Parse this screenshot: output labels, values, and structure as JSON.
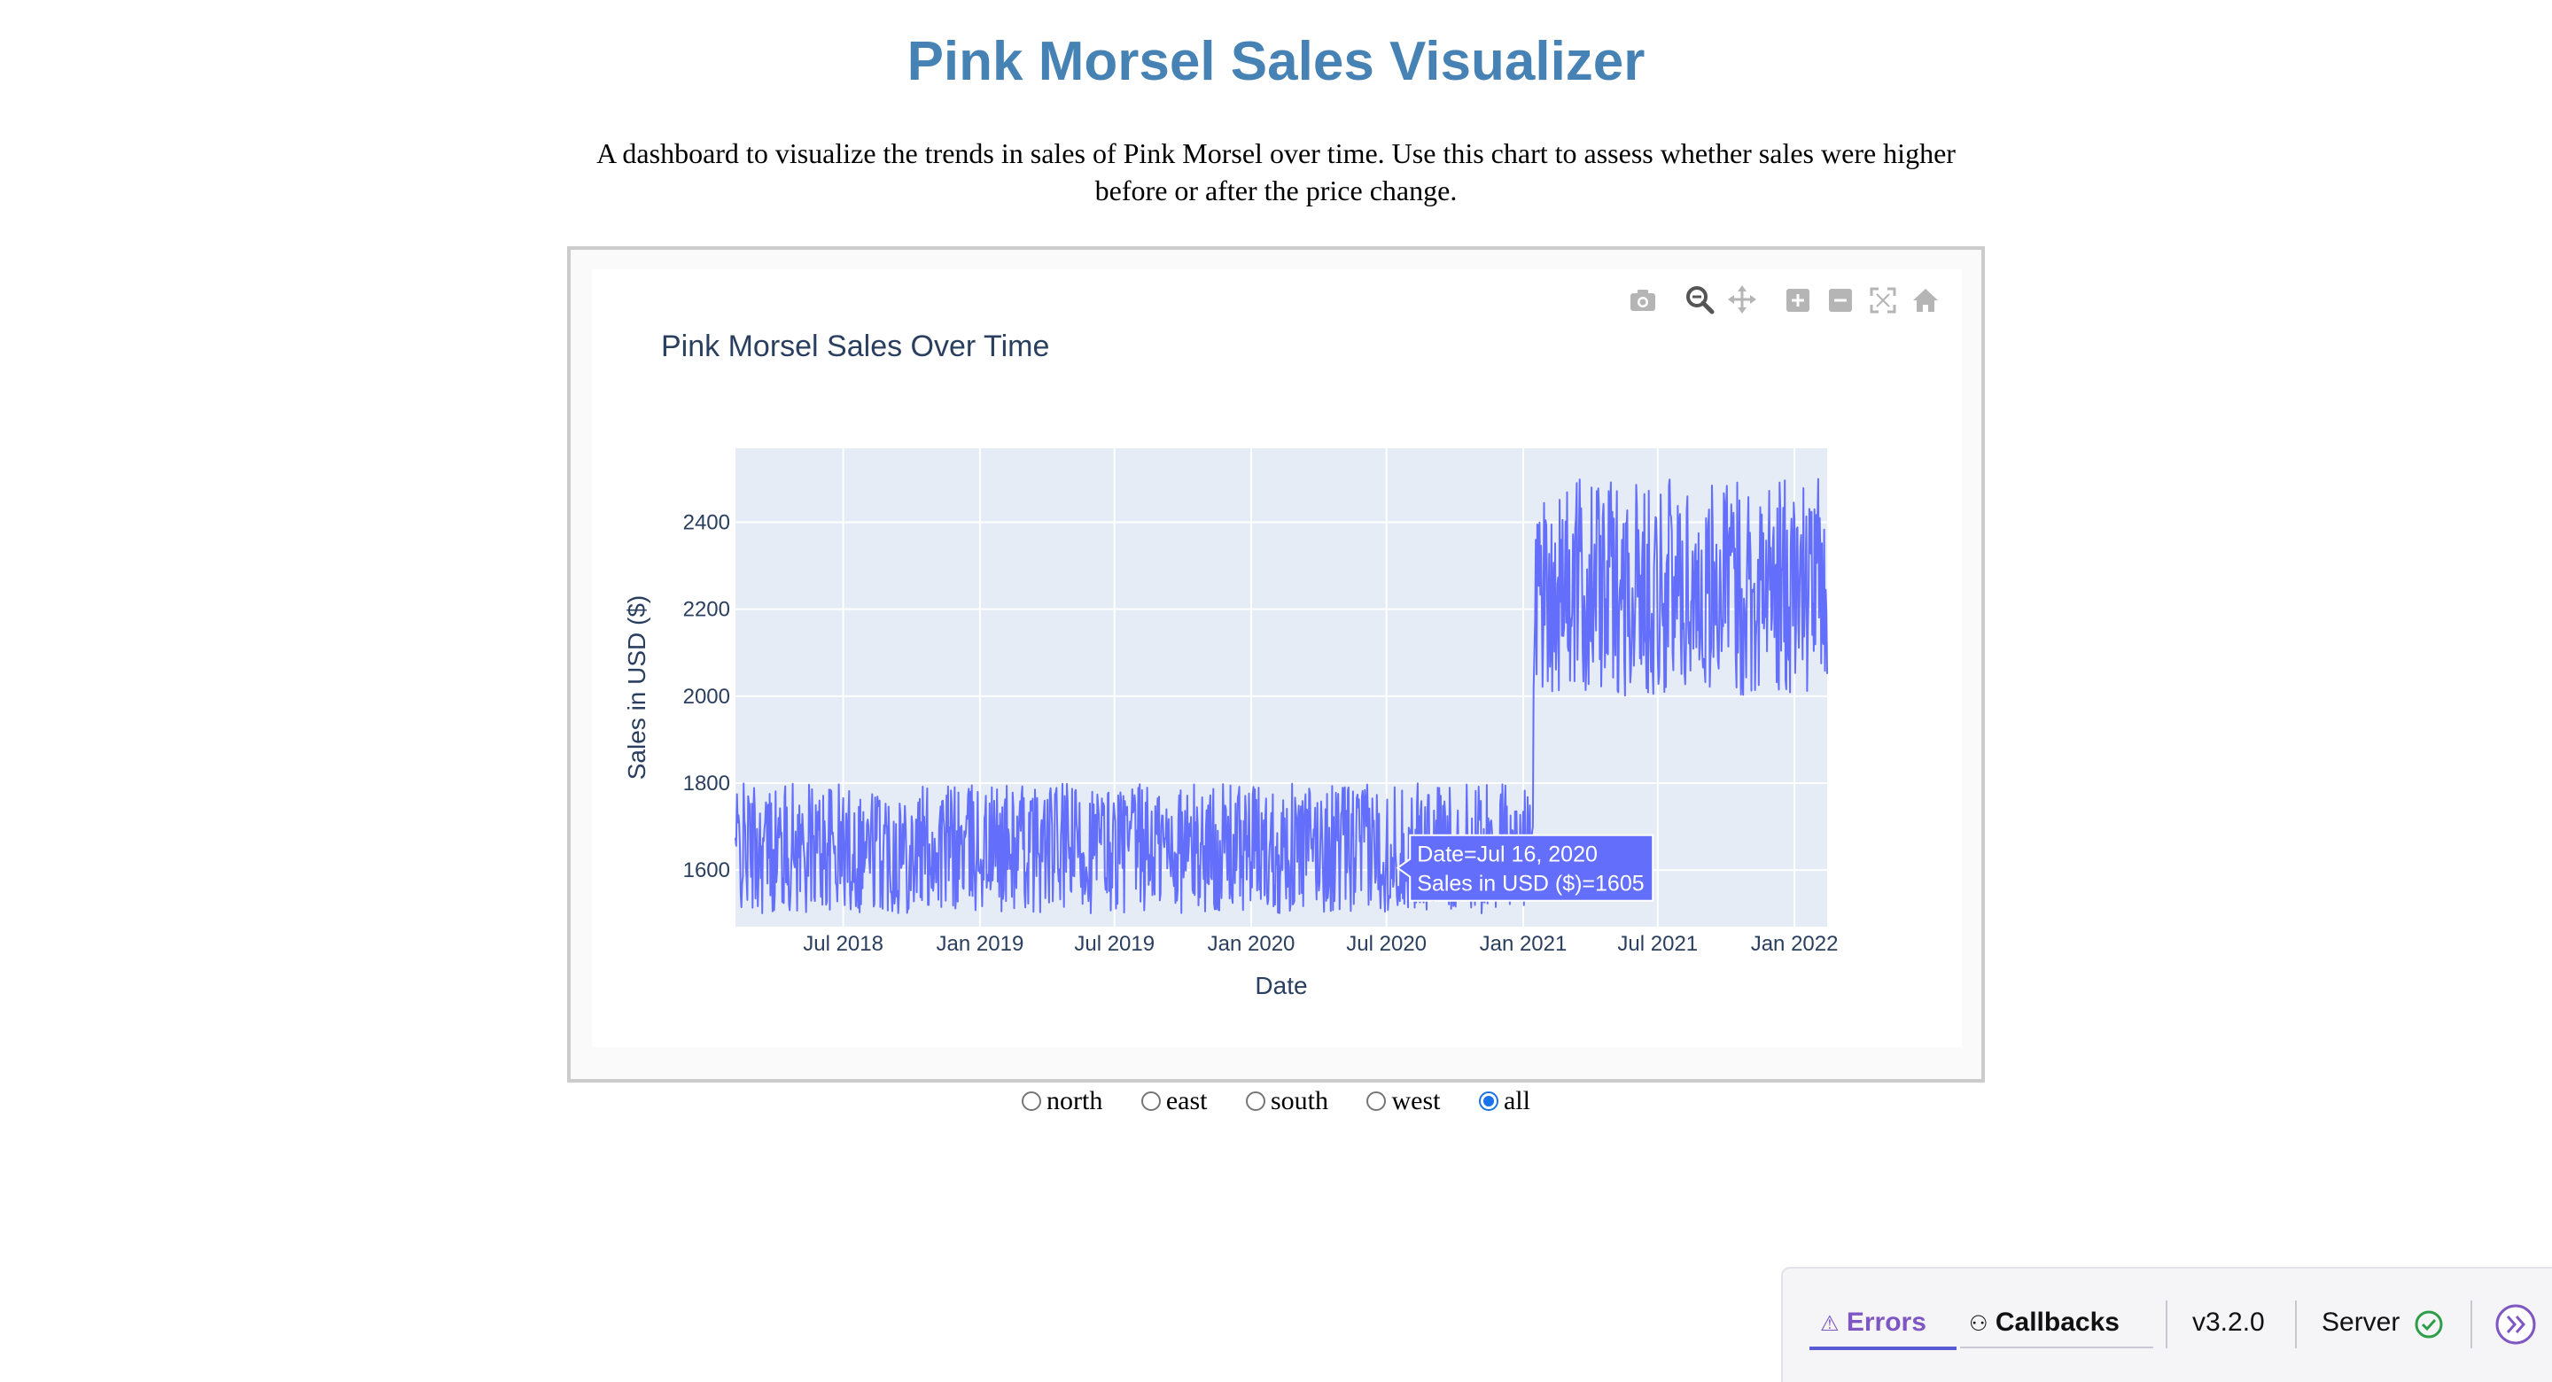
{
  "page": {
    "title": "Pink Morsel Sales Visualizer",
    "description": "A dashboard to visualize the trends in sales of Pink Morsel over time. Use this chart to assess whether sales were higher before or after the price change."
  },
  "colors": {
    "title": "#4682b4",
    "series": "#636efa",
    "plot_bg": "#e5ecf6",
    "radio_checked": "#1a73e8",
    "devtools_accent": "#7e57c2",
    "server_ok": "#2e9d4a"
  },
  "modebar": {
    "icons": [
      "camera-icon",
      "zoom-icon",
      "pan-icon",
      "zoom-in-icon",
      "zoom-out-icon",
      "autoscale-icon",
      "reset-axes-icon",
      "plotly-logo-icon"
    ]
  },
  "chart_data": {
    "type": "line",
    "title": "Pink Morsel Sales Over Time",
    "xlabel": "Date",
    "ylabel": "Sales in USD ($)",
    "x_range": [
      "2018-02-06",
      "2022-02-14"
    ],
    "ylim": [
      1470,
      2570
    ],
    "x_ticks": [
      {
        "date": "2018-07-01",
        "label": "Jul 2018"
      },
      {
        "date": "2019-01-01",
        "label": "Jan 2019"
      },
      {
        "date": "2019-07-01",
        "label": "Jul 2019"
      },
      {
        "date": "2020-01-01",
        "label": "Jan 2020"
      },
      {
        "date": "2020-07-01",
        "label": "Jul 2020"
      },
      {
        "date": "2021-01-01",
        "label": "Jan 2021"
      },
      {
        "date": "2021-07-01",
        "label": "Jul 2021"
      },
      {
        "date": "2022-01-01",
        "label": "Jan 2022"
      }
    ],
    "y_ticks": [
      1600,
      1800,
      2000,
      2200,
      2400
    ],
    "grid": true,
    "series": [
      {
        "start": "2018-02-06",
        "price_change": "2021-01-15",
        "end": "2022-02-14",
        "before_range": [
          1500,
          1800
        ],
        "after_range": [
          2000,
          2500
        ]
      }
    ],
    "hover": {
      "date": "2020-07-16",
      "value": 1605,
      "line1": "Date=Jul 16, 2020",
      "line2": "Sales in USD ($)=1605"
    }
  },
  "radio": {
    "options": [
      {
        "label": "north",
        "checked": false
      },
      {
        "label": "east",
        "checked": false
      },
      {
        "label": "south",
        "checked": false
      },
      {
        "label": "west",
        "checked": false
      },
      {
        "label": "all",
        "checked": true
      }
    ]
  },
  "devtools": {
    "errors_icon": "⚠",
    "errors_label": "Errors",
    "callbacks_icon": "⚇",
    "callbacks_label": "Callbacks",
    "version": "v3.2.0",
    "server_label": "Server"
  }
}
